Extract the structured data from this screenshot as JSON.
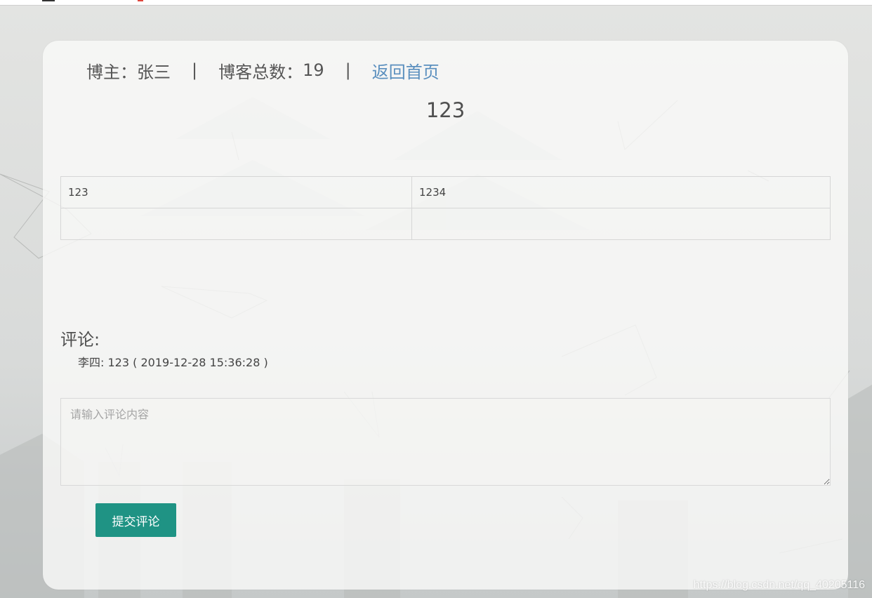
{
  "header": {
    "blogger_label": "博主：",
    "blogger_name": "张三",
    "separator": "|",
    "post_count_label": "博客总数：",
    "post_count": "19",
    "home_link": "返回首页"
  },
  "post": {
    "title": "123",
    "table": {
      "rows": [
        [
          "123",
          "1234"
        ],
        [
          "",
          ""
        ]
      ]
    }
  },
  "comments": {
    "heading": "评论:",
    "items": [
      {
        "author": "李四",
        "separator": ":",
        "content": "123",
        "time": "( 2019-12-28 15:36:28 )"
      }
    ]
  },
  "comment_form": {
    "placeholder": "请输入评论内容",
    "value": "",
    "submit_label": "提交评论"
  },
  "watermark": "https://blog.csdn.net/qq_40205116",
  "colors": {
    "link": "#5a8fbe",
    "submit_button": "#1f9384",
    "text": "#555555"
  }
}
